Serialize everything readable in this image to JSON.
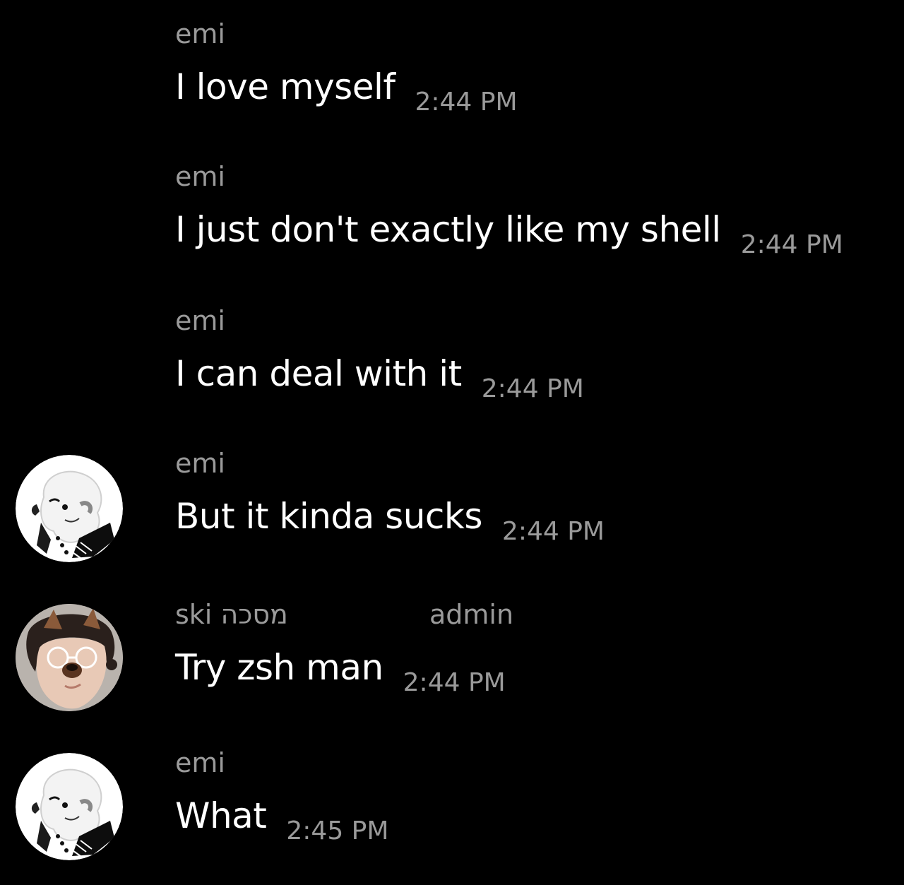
{
  "messages": [
    {
      "author": "emi",
      "text": "I love myself",
      "time": "2:44 PM"
    },
    {
      "author": "emi",
      "text": "I just don't exactly like my shell",
      "time": "2:44 PM"
    },
    {
      "author": "emi",
      "text": "I can deal with it",
      "time": "2:44 PM"
    },
    {
      "author": "emi",
      "text": "But it kinda sucks",
      "time": "2:44 PM",
      "avatar": "emi-avatar"
    },
    {
      "author": "ski מסכה",
      "role": "admin",
      "text": "Try zsh man",
      "time": "2:44 PM",
      "avatar": "ski-avatar"
    },
    {
      "author": "emi",
      "text": "What",
      "time": "2:45 PM",
      "avatar": "emi-avatar"
    }
  ],
  "colors": {
    "background": "#000000",
    "message_text": "#ffffff",
    "meta_text": "#9a9a9a"
  }
}
